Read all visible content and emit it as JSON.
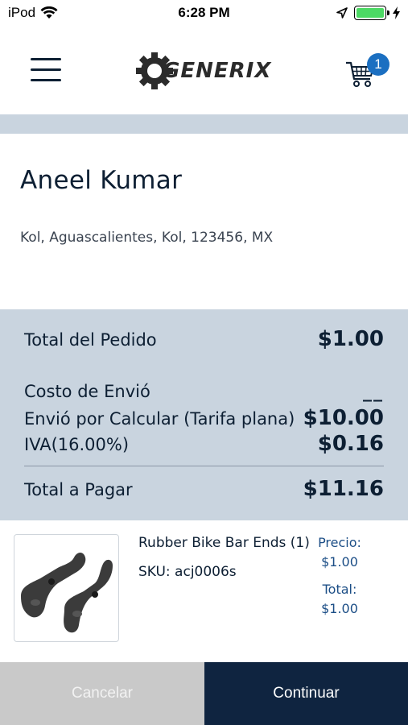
{
  "status_bar": {
    "carrier": "iPod",
    "time": "6:28 PM"
  },
  "header": {
    "logo_text": "GENERIX",
    "cart_count": "1"
  },
  "customer": {
    "name": "Aneel Kumar",
    "address": "Kol, Aguascalientes, Kol, 123456, MX"
  },
  "summary": {
    "total_pedido_label": "Total del Pedido",
    "total_pedido_value": "$1.00",
    "costo_envio_label": "Costo de Envió",
    "costo_envio_value": "__",
    "envio_label": "Envió por Calcular (Tarifa plana)",
    "envio_value": "$10.00",
    "iva_label": "IVA(16.00%)",
    "iva_value": "$0.16",
    "total_pagar_label": "Total a Pagar",
    "total_pagar_value": "$11.16"
  },
  "product": {
    "name": "Rubber Bike Bar Ends (1)",
    "sku": "SKU: acj0006s",
    "precio_label": "Precio:",
    "precio_value": "$1.00",
    "total_label": "Total:",
    "total_value": "$1.00"
  },
  "actions": {
    "cancel_label": "Cancelar",
    "continue_label": "Continuar"
  },
  "colors": {
    "summary_bg": "#c9d4df",
    "continue_bg": "#0f2440",
    "cancel_bg": "#c9c9c9",
    "badge": "#1b6fc1",
    "battery": "#4cd964"
  }
}
